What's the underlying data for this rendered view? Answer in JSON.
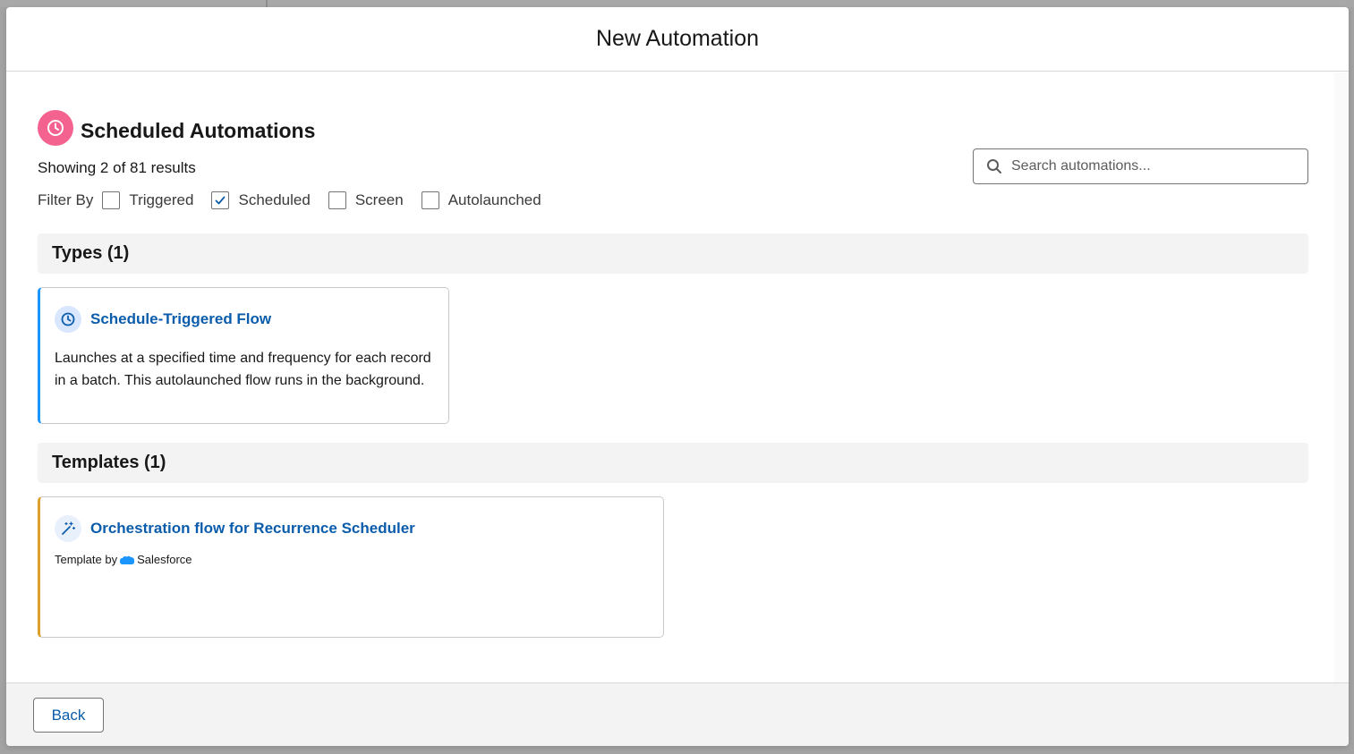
{
  "modal": {
    "title": "New Automation"
  },
  "section": {
    "title": "Scheduled Automations",
    "results": "Showing 2 of 81 results",
    "icon": "clock-icon",
    "icon_color": "#f4638f"
  },
  "search": {
    "placeholder": "Search automations...",
    "value": ""
  },
  "filter": {
    "label": "Filter By",
    "options": [
      {
        "label": "Triggered",
        "checked": false
      },
      {
        "label": "Scheduled",
        "checked": true
      },
      {
        "label": "Screen",
        "checked": false
      },
      {
        "label": "Autolaunched",
        "checked": false
      }
    ]
  },
  "groups": [
    {
      "title": "Types (1)",
      "cards": [
        {
          "title": "Schedule-Triggered Flow",
          "icon": "clock-icon",
          "accent": "#1b96ff",
          "description": "Launches at a specified time and frequency for each record in a batch. This autolaunched flow runs in the background."
        }
      ]
    },
    {
      "title": "Templates (1)",
      "cards": [
        {
          "title": "Orchestration flow for Recurrence Scheduler",
          "icon": "magic-wand-icon",
          "accent": "#dd9f2b",
          "template_by": "Template by",
          "publisher": "Salesforce",
          "publisher_icon": "salesforce-cloud-icon"
        }
      ]
    }
  ],
  "footer": {
    "back_label": "Back"
  },
  "colors": {
    "link": "#0b5cab",
    "brand_cloud": "#1b96ff"
  }
}
